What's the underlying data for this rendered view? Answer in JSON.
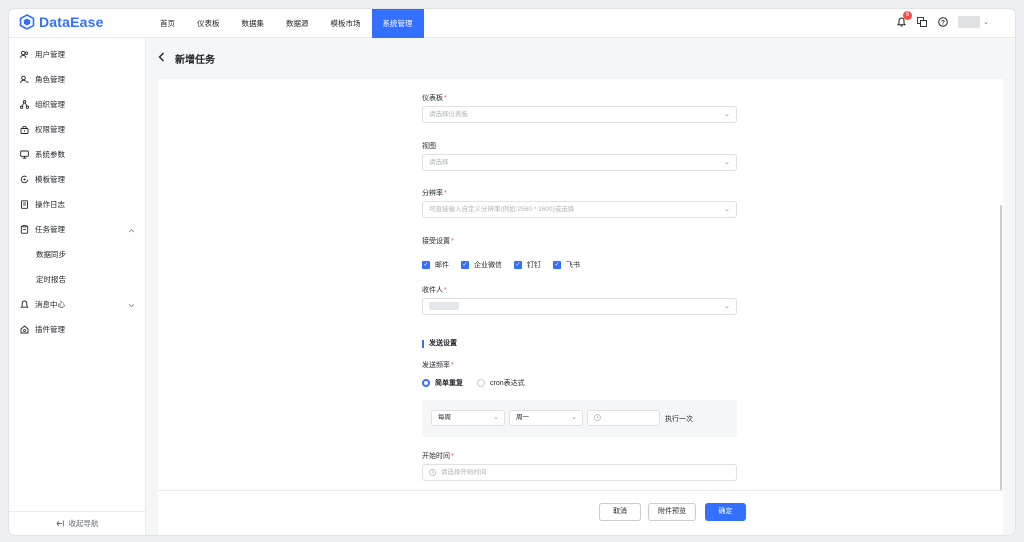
{
  "app": {
    "name": "DataEase",
    "brand_color": "#3370ff"
  },
  "nav": [
    {
      "label": "首页",
      "active": false
    },
    {
      "label": "仪表板",
      "active": false
    },
    {
      "label": "数据集",
      "active": false
    },
    {
      "label": "数据源",
      "active": false
    },
    {
      "label": "模板市场",
      "active": false
    },
    {
      "label": "系统管理",
      "active": true
    }
  ],
  "header": {
    "notification_count": "6"
  },
  "sidebar": {
    "items": [
      {
        "label": "用户管理",
        "icon": "users-icon"
      },
      {
        "label": "角色管理",
        "icon": "role-icon"
      },
      {
        "label": "组织管理",
        "icon": "org-icon"
      },
      {
        "label": "权限管理",
        "icon": "lock-icon"
      },
      {
        "label": "系统参数",
        "icon": "monitor-icon"
      },
      {
        "label": "模板管理",
        "icon": "template-icon"
      },
      {
        "label": "操作日志",
        "icon": "log-icon"
      },
      {
        "label": "任务管理",
        "icon": "task-icon",
        "expanded": true
      },
      {
        "label": "数据同步",
        "sub": true
      },
      {
        "label": "定时报告",
        "sub": true
      },
      {
        "label": "消息中心",
        "icon": "bell-icon",
        "expanded": false
      },
      {
        "label": "插件管理",
        "icon": "plugin-icon"
      }
    ],
    "collapse_label": "收起导航"
  },
  "page": {
    "title": "新增任务"
  },
  "form": {
    "dashboard": {
      "label": "仪表板",
      "required": "*",
      "placeholder": "请选择仪表板"
    },
    "view": {
      "label": "视图",
      "placeholder": "请选择"
    },
    "resolution": {
      "label": "分辨率",
      "required": "*",
      "placeholder": "可直接输入自定义分辨率(例如:2560 * 1600)或选择"
    },
    "receive": {
      "label": "接受设置",
      "required": "*",
      "options": [
        {
          "label": "邮件",
          "checked": true
        },
        {
          "label": "企业微信",
          "checked": true
        },
        {
          "label": "钉钉",
          "checked": true
        },
        {
          "label": "飞书",
          "checked": true
        }
      ]
    },
    "recipients": {
      "label": "收件人",
      "required": "*"
    },
    "send_section": "发送设置",
    "send_freq": {
      "label": "发送频率",
      "required": "*",
      "options": [
        {
          "label": "简单重复",
          "selected": true
        },
        {
          "label": "cron表达式",
          "selected": false
        }
      ],
      "period": "每周",
      "weekday": "周一",
      "exec_label": "执行一次"
    },
    "start_time": {
      "label": "开始时间",
      "required": "*",
      "placeholder": "请选择开始时间"
    }
  },
  "footer": {
    "cancel": "取消",
    "preview": "附件预览",
    "confirm": "确定"
  }
}
